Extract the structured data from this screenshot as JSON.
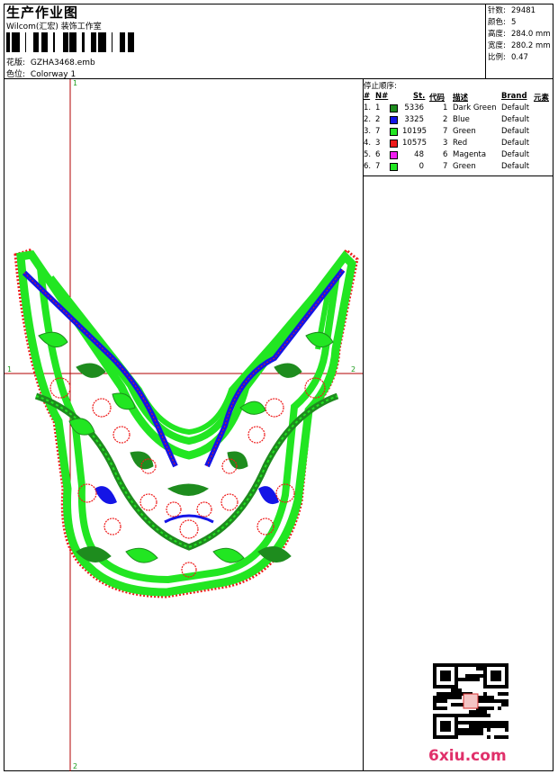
{
  "header": {
    "title": "生产作业图",
    "company": "Wilcom(汇宏) 装饰工作室",
    "design_label": "花版:",
    "design_value": "GZHA3468.emb",
    "colorway_label": "色位:",
    "colorway_value": "Colorway 1"
  },
  "stats": [
    {
      "label": "针数:",
      "value": "29481"
    },
    {
      "label": "颜色:",
      "value": "5"
    },
    {
      "label": "高度:",
      "value": "284.0 mm"
    },
    {
      "label": "宽度:",
      "value": "280.2 mm"
    },
    {
      "label": "比例:",
      "value": "0.47"
    }
  ],
  "stop_sequence": {
    "title": "停止顺序:",
    "headers": {
      "num": "#",
      "n": "N#",
      "st": "St.",
      "code": "代码",
      "desc": "描述",
      "brand": "Brand",
      "elem": "元素"
    },
    "rows": [
      {
        "num": "1.",
        "n": "1",
        "color": "#1e8c1e",
        "st": "5336",
        "code": "1",
        "desc": "Dark Green",
        "brand": "Default"
      },
      {
        "num": "2.",
        "n": "2",
        "color": "#1414e6",
        "st": "3325",
        "code": "2",
        "desc": "Blue",
        "brand": "Default"
      },
      {
        "num": "3.",
        "n": "7",
        "color": "#22e622",
        "st": "10195",
        "code": "7",
        "desc": "Green",
        "brand": "Default"
      },
      {
        "num": "4.",
        "n": "3",
        "color": "#ee1a1a",
        "st": "10575",
        "code": "3",
        "desc": "Red",
        "brand": "Default"
      },
      {
        "num": "5.",
        "n": "6",
        "color": "#f01ef0",
        "st": "48",
        "code": "6",
        "desc": "Magenta",
        "brand": "Default"
      },
      {
        "num": "6.",
        "n": "7",
        "color": "#22e622",
        "st": "0",
        "code": "7",
        "desc": "Green",
        "brand": "Default"
      }
    ]
  },
  "guides": {
    "v_top": "1",
    "v_bottom": "2",
    "h_left": "1",
    "h_right": "2"
  },
  "watermark": "6xiu.com",
  "colors": {
    "dark_green": "#1e8c1e",
    "blue": "#1414e6",
    "green": "#22e622",
    "red": "#ee1a1a",
    "guide": "#b00000"
  }
}
